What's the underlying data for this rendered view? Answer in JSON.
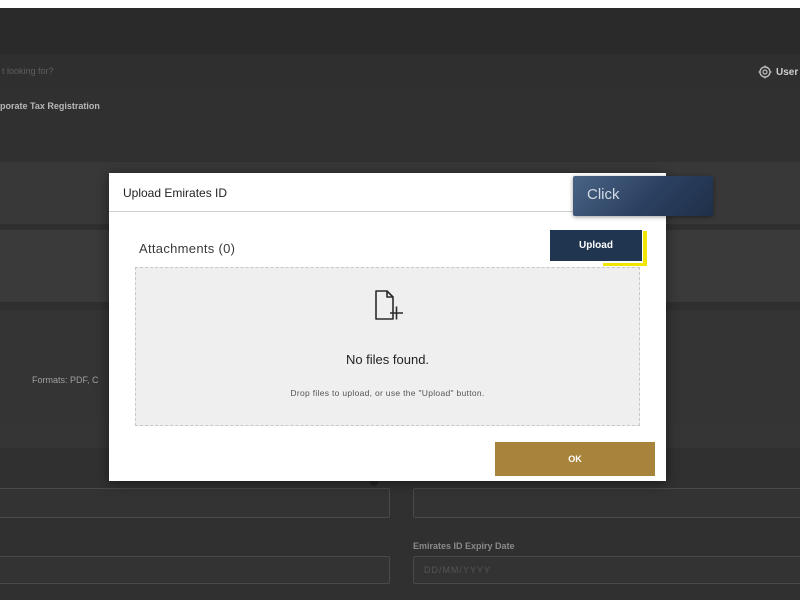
{
  "background": {
    "search_placeholder": "t looking for?",
    "user_label": "User",
    "breadcrumb": "porate Tax Registration",
    "formats_text": "Formats: PDF, C",
    "expiry_label": "Emirates ID Expiry Date",
    "expiry_placeholder": "DD/MM/YYYY"
  },
  "modal": {
    "title": "Upload Emirates ID",
    "attachments_title": "Attachments (0)",
    "upload_label": "Upload",
    "empty_title": "No files found.",
    "empty_hint": "Drop files to upload, or use the \"Upload\" button.",
    "ok_label": "OK"
  },
  "callout": {
    "text": "Click"
  },
  "colors": {
    "upload_button": "#1f3550",
    "ok_button": "#a7833b",
    "highlight": "#f2e600",
    "overlay": "#2f2f2f"
  },
  "icons": {
    "user": "gear-icon",
    "empty_state": "file-add-icon"
  }
}
